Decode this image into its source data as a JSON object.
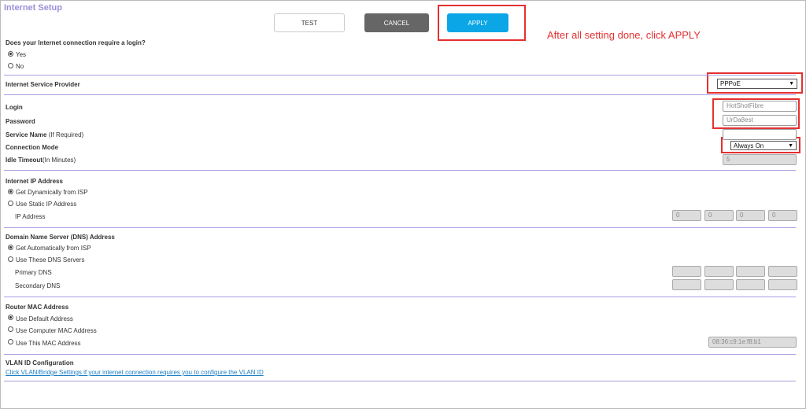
{
  "header": {
    "title": "Internet Setup"
  },
  "toolbar": {
    "test_label": "TEST",
    "cancel_label": "CANCEL",
    "apply_label": "APPLY"
  },
  "annotation": {
    "text": "After all setting done, click APPLY",
    "color": "#e53030"
  },
  "login_required": {
    "question": "Does your Internet connection require a login?",
    "options": [
      "Yes",
      "No"
    ],
    "selected": "Yes"
  },
  "isp": {
    "label": "Internet Service Provider",
    "value": "PPPoE"
  },
  "account": {
    "login_label": "Login",
    "login_value": "HotShotFibre",
    "password_label": "Password",
    "password_value": "UrDa8est",
    "service_label": "Service Name",
    "service_hint": "(If Required)",
    "mode_label": "Connection Mode",
    "mode_value": "Always On",
    "idle_label": "Idle Timeout",
    "idle_hint": "(In Minutes)",
    "idle_value": "5"
  },
  "ip": {
    "title": "Internet IP Address",
    "opt_dynamic": "Get Dynamically from ISP",
    "opt_static": "Use Static IP Address",
    "field_label": "IP Address",
    "octets": [
      "0",
      "0",
      "0",
      "0"
    ]
  },
  "dns": {
    "title": "Domain Name Server (DNS) Address",
    "opt_auto": "Get Automatically from ISP",
    "opt_manual": "Use These DNS Servers",
    "primary_label": "Primary DNS",
    "secondary_label": "Secondary DNS"
  },
  "mac": {
    "title": "Router MAC Address",
    "opt_default": "Use Default Address",
    "opt_computer": "Use Computer MAC Address",
    "opt_this": "Use This MAC Address",
    "value": "08:36:c9:1e:f8:b1"
  },
  "vlan": {
    "title": "VLAN ID Configuration",
    "link_text": "Click VLAN/Bridge Settings if your internet connection requires you to configure the VLAN ID"
  },
  "colors": {
    "accent": "#9b8ed8",
    "apply": "#0aa6e6",
    "cancel": "#666666",
    "highlight": "#e53030",
    "divider": "#a89ee0"
  }
}
